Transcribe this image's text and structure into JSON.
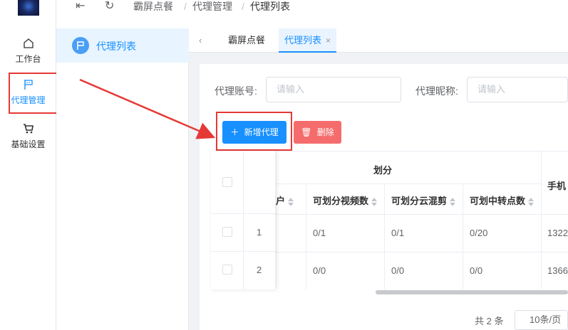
{
  "header": {
    "crumbs": [
      "霸屏点餐",
      "代理管理",
      "代理列表"
    ],
    "icons": [
      "fold-menu-icon",
      "refresh-icon"
    ]
  },
  "rail": {
    "items": [
      {
        "label": "工作台",
        "icon": "home-icon"
      },
      {
        "label": "代理管理",
        "icon": "flag-icon"
      },
      {
        "label": "基础设置",
        "icon": "cart-icon"
      }
    ]
  },
  "submenu": {
    "item": "代理列表"
  },
  "tabs": [
    {
      "label": "霸屏点餐"
    },
    {
      "label": "代理列表",
      "close": "×"
    }
  ],
  "search": {
    "account_label": "代理账号:",
    "account_placeholder": "请输入",
    "nickname_label": "代理昵称:",
    "nickname_placeholder": "请输入"
  },
  "toolbar": {
    "add_label": "新增代理",
    "delete_label": "删除"
  },
  "table": {
    "group_header": "划分",
    "phone_header": "手机",
    "columns": [
      "户",
      "可划分视频数",
      "可划分云混剪",
      "可划中转点数"
    ],
    "rows": [
      {
        "index": "1",
        "video": "0/1",
        "cloud": "0/1",
        "transfer": "0/20",
        "phone": "1322"
      },
      {
        "index": "2",
        "video": "0/0",
        "cloud": "0/0",
        "transfer": "0/0",
        "phone": "1366"
      }
    ]
  },
  "pager": {
    "total": "共 2 条",
    "size": "10条/页"
  },
  "colors": {
    "accent": "#1890ff",
    "danger": "#f56c6c",
    "annotation": "#e53935"
  }
}
